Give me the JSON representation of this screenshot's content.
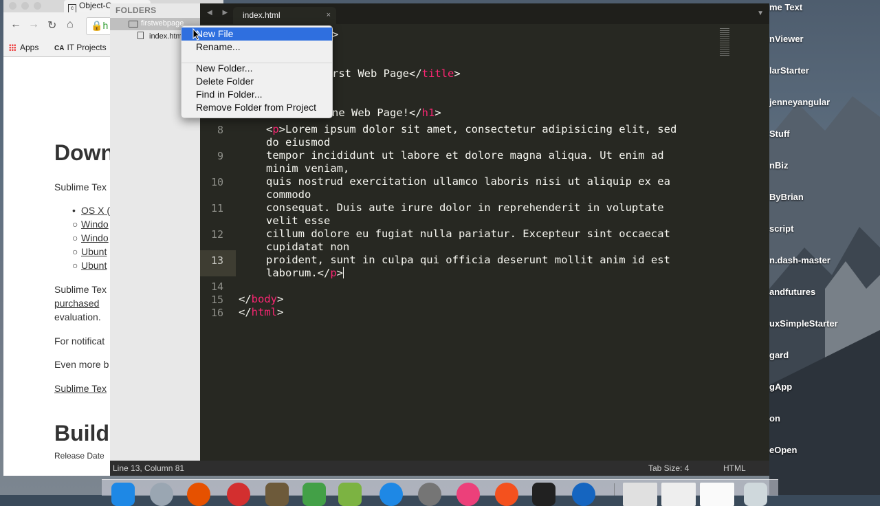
{
  "desktop": {
    "labels": [
      "me Text",
      "nViewer",
      "larStarter",
      "jenneyangular",
      "Stuff",
      "nBiz",
      "ByBrian",
      "script",
      "n.dash-master",
      "andfutures",
      "uxSimpleStarter",
      "gard",
      "gApp",
      "on",
      "eOpen"
    ]
  },
  "browser": {
    "tab_title": "Object-O",
    "address_partial": "h",
    "bookmarks": {
      "apps": "Apps",
      "it_projects": "IT Projects"
    },
    "page": {
      "heading_download": "Down",
      "intro": "Sublime Tex",
      "items": [
        "OS X (",
        "Windo",
        "Windo",
        "Ubunt",
        "Ubunt"
      ],
      "para1_a": "Sublime Tex",
      "para1_b": "purchased",
      "para1_c": "evaluation.",
      "para2": "For notificat",
      "para3": "Even more b",
      "para4": "Sublime Tex",
      "heading_build": "Build",
      "release": "Release Date"
    }
  },
  "sublime": {
    "sidebar": {
      "header": "FOLDERS",
      "folder": "firstwebpage",
      "file": "index.htm"
    },
    "tabs": {
      "active": "index.html",
      "close": "×",
      "arrows": "◀ ▶",
      "dropdown": "▼"
    },
    "code": {
      "line2_frag": ">",
      "line4_frag": "rst Web Page</",
      "line4_tag": "title",
      "line4_end": ">",
      "line7_frag": "ne Web Page!</",
      "line7_tag": "h1",
      "line7_end": ">",
      "lines": [
        {
          "n": "8",
          "text": "Lorem ipsum dolor sit amet, consectetur adipisicing elit, sed",
          "cont": "do eiusmod"
        },
        {
          "n": "9",
          "text": "tempor incididunt ut labore et dolore magna aliqua. Ut enim ad",
          "cont": "minim veniam,"
        },
        {
          "n": "10",
          "text": "quis nostrud exercitation ullamco laboris nisi ut aliquip ex ea",
          "cont": "commodo"
        },
        {
          "n": "11",
          "text": "consequat. Duis aute irure dolor in reprehenderit in voluptate",
          "cont": "velit esse"
        },
        {
          "n": "12",
          "text": "cillum dolore eu fugiat nulla pariatur. Excepteur sint occaecat",
          "cont": "cupidatat non"
        },
        {
          "n": "13",
          "text": "proident, sunt in culpa qui officia deserunt mollit anim id est",
          "cont": "laborum.</"
        }
      ],
      "p_tag": "p",
      "ln14": "14",
      "ln15": "15",
      "ln16": "16",
      "body_tag": "body",
      "html_tag": "html"
    },
    "status": {
      "position": "Line 13, Column 81",
      "tab_size": "Tab Size: 4",
      "syntax": "HTML"
    }
  },
  "context_menu": {
    "items": [
      "New File",
      "Rename...",
      "New Folder...",
      "Delete Folder",
      "Find in Folder...",
      "Remove Folder from Project"
    ],
    "selected": "New File"
  },
  "colors": {
    "tag": "#f92672",
    "editor_bg": "#272822",
    "menu_highlight": "#2f6fdf"
  }
}
